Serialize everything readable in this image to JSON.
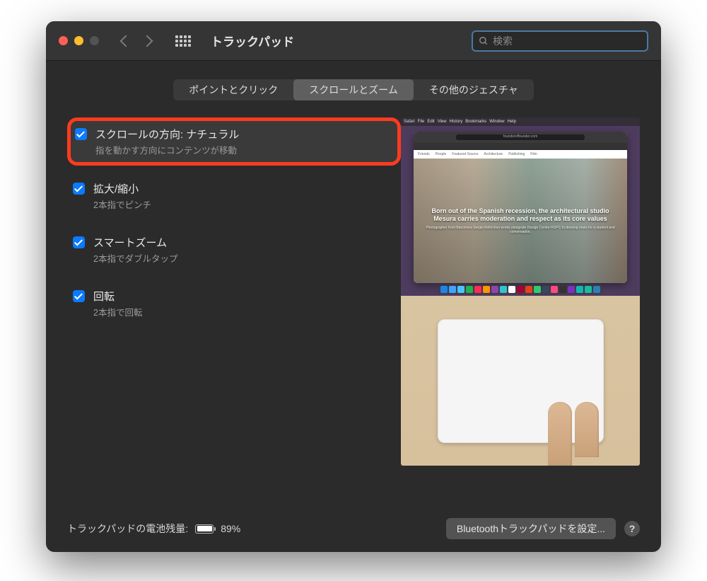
{
  "window": {
    "title": "トラックパッド",
    "search_placeholder": "検索"
  },
  "tabs": {
    "point": "ポイントとクリック",
    "scroll": "スクロールとズーム",
    "gestures": "その他のジェスチャ",
    "active_index": 1
  },
  "options": {
    "natural_scroll": {
      "title": "スクロールの方向: ナチュラル",
      "subtitle": "指を動かす方向にコンテンツが移動",
      "checked": true,
      "highlighted": true
    },
    "zoom": {
      "title": "拡大/縮小",
      "subtitle": "2本指でピンチ",
      "checked": true
    },
    "smart_zoom": {
      "title": "スマートズーム",
      "subtitle": "2本指でダブルタップ",
      "checked": true
    },
    "rotate": {
      "title": "回転",
      "subtitle": "2本指で回転",
      "checked": true
    }
  },
  "preview": {
    "hero_title": "Born out of the Spanish recession, the architectural studio Mesura carries moderation and respect as its core values",
    "url": "founderoffounder.com"
  },
  "footer": {
    "battery_label": "トラックパッドの電池残量:",
    "battery_pct": "89%",
    "bluetooth_btn": "Bluetoothトラックパッドを設定...",
    "help": "?"
  }
}
